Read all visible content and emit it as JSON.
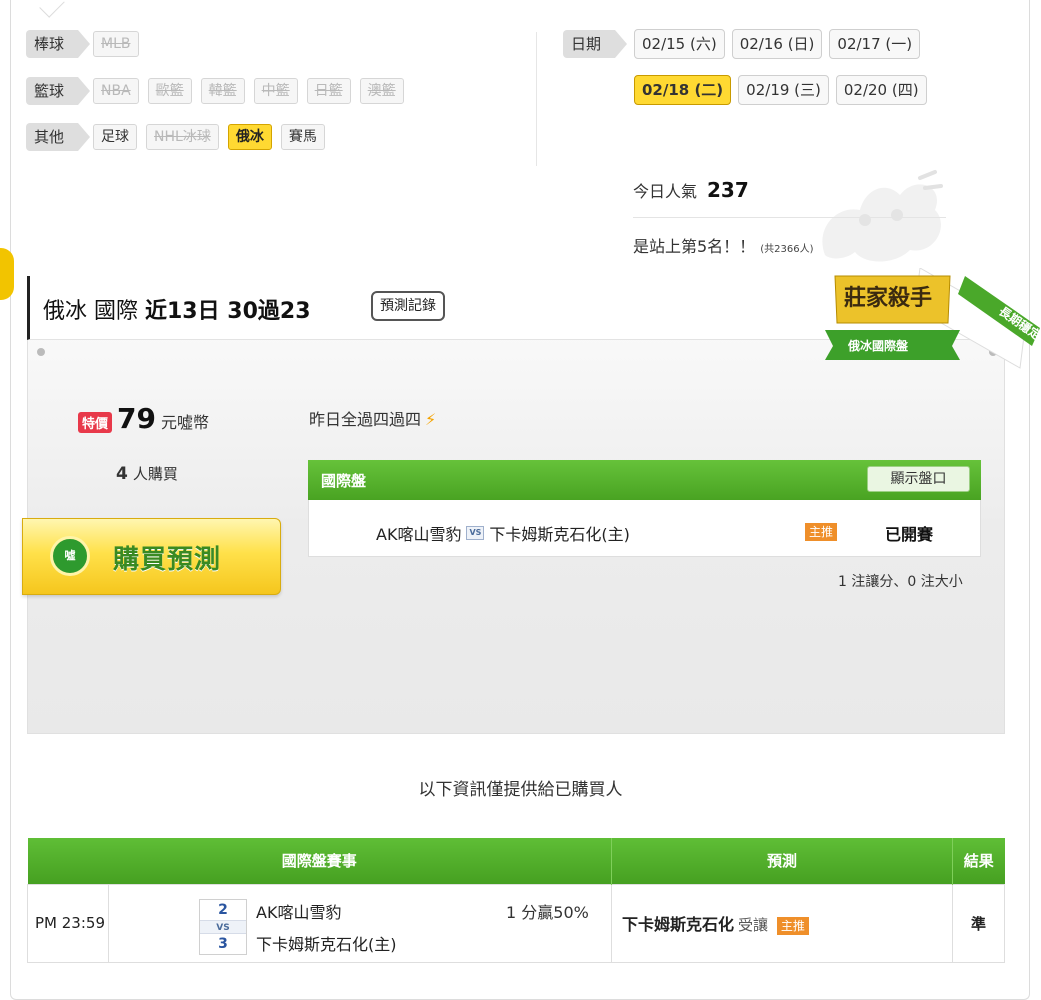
{
  "categories": [
    {
      "label": "棒球",
      "items": [
        {
          "text": "MLB",
          "state": "disabled"
        }
      ]
    },
    {
      "label": "籃球",
      "items": [
        {
          "text": "NBA",
          "state": "disabled"
        },
        {
          "text": "歐籃",
          "state": "disabled"
        },
        {
          "text": "韓籃",
          "state": "disabled"
        },
        {
          "text": "中籃",
          "state": "disabled"
        },
        {
          "text": "日籃",
          "state": "disabled"
        },
        {
          "text": "澳籃",
          "state": "disabled"
        }
      ]
    },
    {
      "label": "其他",
      "items": [
        {
          "text": "足球",
          "state": "normal"
        },
        {
          "text": "NHL冰球",
          "state": "disabled"
        },
        {
          "text": "俄冰",
          "state": "active"
        },
        {
          "text": "賽馬",
          "state": "normal"
        }
      ]
    }
  ],
  "dates": {
    "label": "日期",
    "row1": [
      "02/15 (六)",
      "02/16 (日)",
      "02/17 (一)"
    ],
    "row2": [
      "02/18 (二)",
      "02/19 (三)",
      "02/20 (四)"
    ],
    "active": "02/18 (二)"
  },
  "popularity": {
    "label": "今日人氣",
    "value": "237",
    "rank_text": "是站上第5名！！",
    "rank_total": "(共2366人)"
  },
  "header": {
    "title_prefix": "俄冰 國際 ",
    "title_bold": "近13日 30過23",
    "record_button": "預測記錄"
  },
  "badge": {
    "title": "莊家殺手",
    "subtitle": "俄冰國際盤",
    "ribbon": "長期穩定"
  },
  "price": {
    "tag": "特價",
    "value": "79",
    "unit": "元噓幣",
    "buyers_count": "4",
    "buyers_label": "人購買"
  },
  "buy_button": {
    "label": "購買預測",
    "icon_text": "噓"
  },
  "yesterday": "昨日全過四過四",
  "market": {
    "title": "國際盤",
    "show_button": "顯示盤口",
    "team_away": "AK喀山雪豹",
    "vs": "VS",
    "team_home": "下卡姆斯克石化(主)",
    "main_tag": "主推",
    "status": "已開賽",
    "bets_summary": "1 注讓分、0 注大小"
  },
  "notice": "以下資訊僅提供給已購買人",
  "results_table": {
    "headers": [
      "國際盤賽事",
      "預測",
      "結果"
    ],
    "rows": [
      {
        "time": "PM 23:59",
        "score_away": "2",
        "vs": "VS",
        "score_home": "3",
        "team_away": "AK喀山雪豹",
        "team_home": "下卡姆斯克石化(主)",
        "spread": "1 分贏50%",
        "prediction_team": "下卡姆斯克石化",
        "prediction_type": "受讓",
        "prediction_tag": "主推",
        "result": "準"
      }
    ]
  },
  "colors": {
    "accent_yellow": "#ffd932",
    "green_header": "#4fa828",
    "main_tag": "#ef8f2a",
    "special_price": "#e8394a"
  }
}
